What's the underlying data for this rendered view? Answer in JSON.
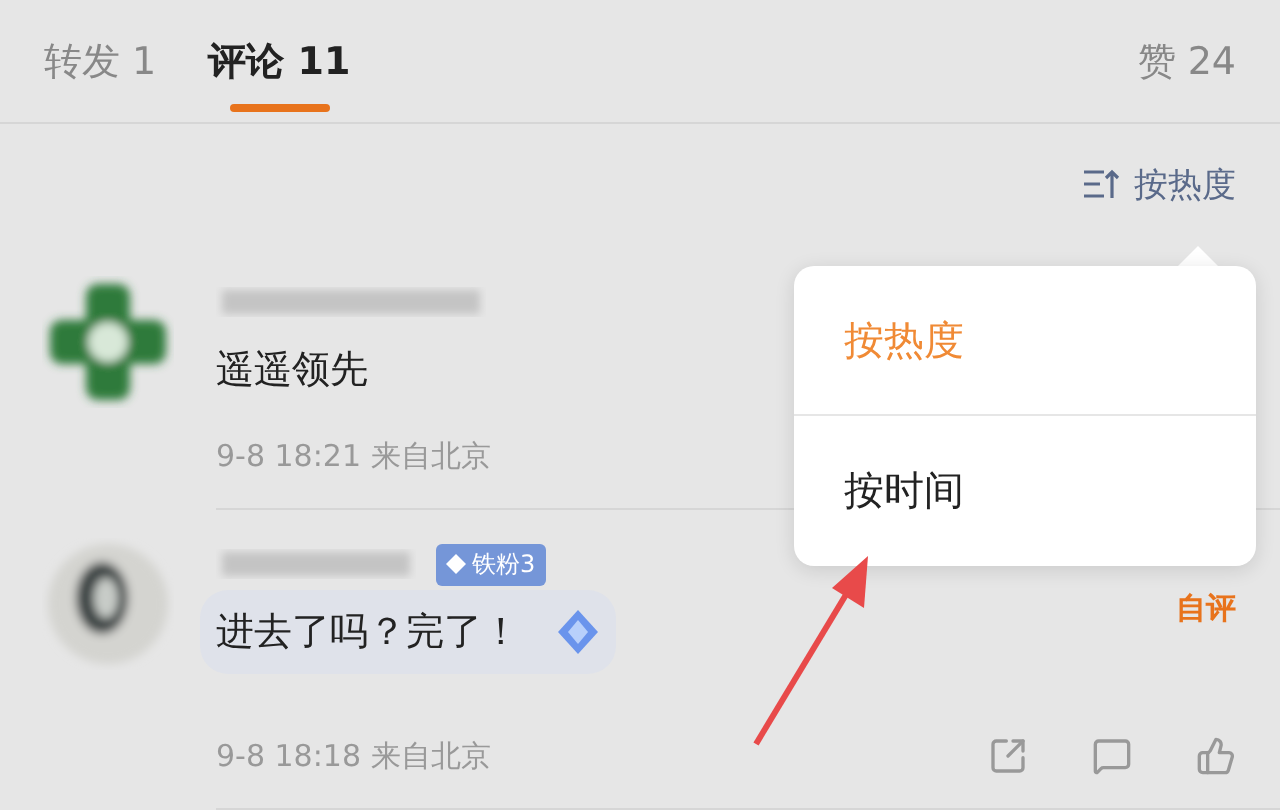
{
  "tabs": [
    {
      "label": "转发 1",
      "selected": false
    },
    {
      "label": "评论 11",
      "selected": true
    }
  ],
  "likes": "赞 24",
  "sort_button": "按热度",
  "comments": [
    {
      "text": "遥遥领先",
      "meta": "9-8 18:21 来自北京",
      "highlighted": false
    },
    {
      "badge": "铁粉3",
      "text": "进去了吗？完了！",
      "meta": "9-8 18:18 来自北京",
      "tag": "自评",
      "highlighted": true
    }
  ],
  "sort_menu": [
    {
      "label": "按热度",
      "selected": true
    },
    {
      "label": "按时间",
      "selected": false
    }
  ]
}
